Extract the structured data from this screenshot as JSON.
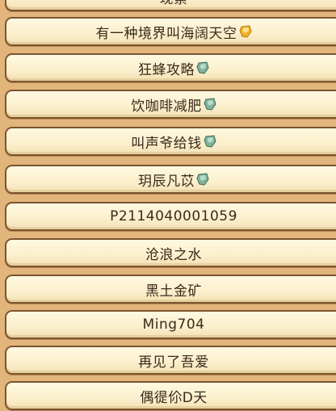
{
  "top_partial_label": "现累",
  "players": [
    {
      "name": "有一种境界叫海阔天空",
      "badge": "gold-gem-icon"
    },
    {
      "name": "狂蜂攻略",
      "badge": "green-gem-icon"
    },
    {
      "name": "饮咖啡减肥",
      "badge": "green-gem-icon"
    },
    {
      "name": "叫声爷给钱",
      "badge": "green-gem-icon"
    },
    {
      "name": "玥辰凡苡",
      "badge": "green-gem-icon"
    },
    {
      "name": "P2114040001059",
      "badge": null
    },
    {
      "name": "沧浪之水",
      "badge": null
    },
    {
      "name": "黑土金矿",
      "badge": null
    },
    {
      "name": "Ming704",
      "badge": null
    },
    {
      "name": "再见了吾爱",
      "badge": null
    },
    {
      "name": "偶徥伱D天",
      "badge": null
    }
  ],
  "colors": {
    "gold_gem": "#f0b429",
    "green_gem": "#7fb39c",
    "row_border": "#7a5530",
    "panel_bg": "#e2b57c"
  }
}
